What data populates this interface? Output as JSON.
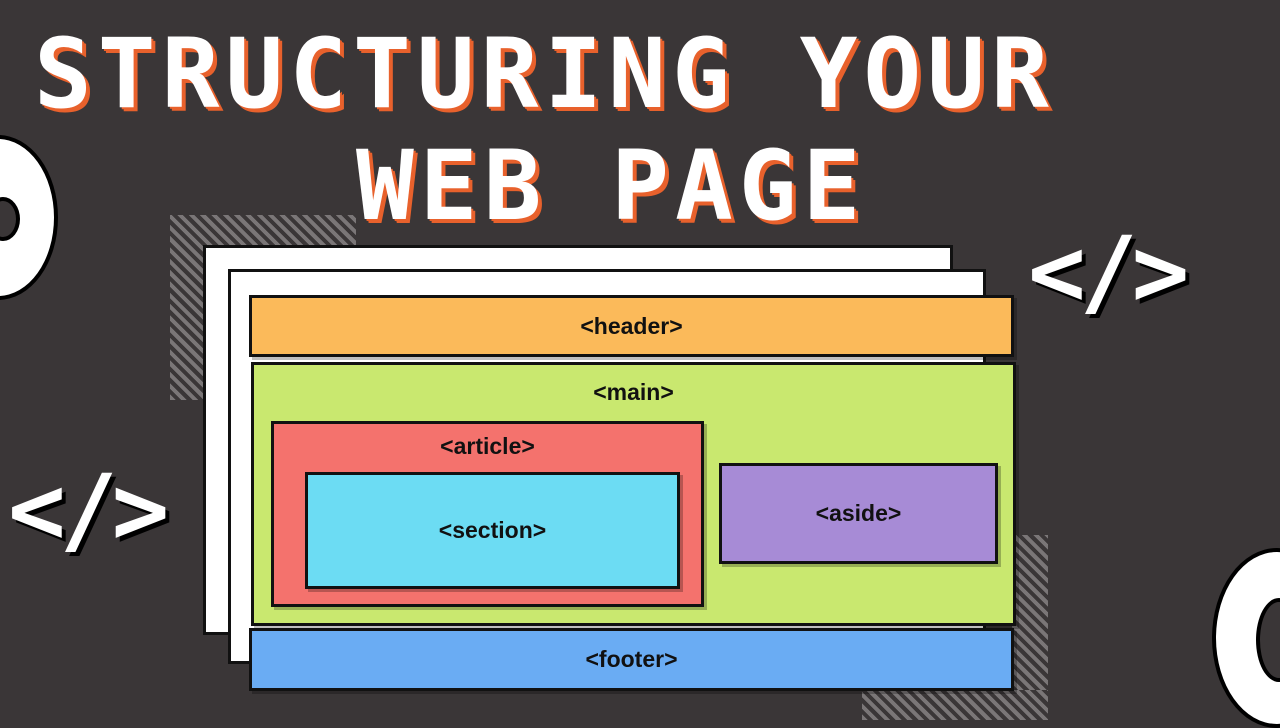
{
  "title": {
    "line1": "STRUCTURING YOUR",
    "line2": "WEB PAGE"
  },
  "decorations": {
    "code_symbol": "</>",
    "ring_icon": "circle-ring-icon"
  },
  "layout_boxes": {
    "header": "<header>",
    "main": "<main>",
    "article": "<article>",
    "section": "<section>",
    "aside": "<aside>",
    "footer": "<footer>"
  },
  "colors": {
    "background": "#3a3637",
    "title_shadow": "#e8612c",
    "header": "#fbba5a",
    "main": "#c9e86f",
    "article": "#f4726d",
    "section": "#6cdcf3",
    "aside": "#a78bd6",
    "footer": "#6aacf3"
  }
}
